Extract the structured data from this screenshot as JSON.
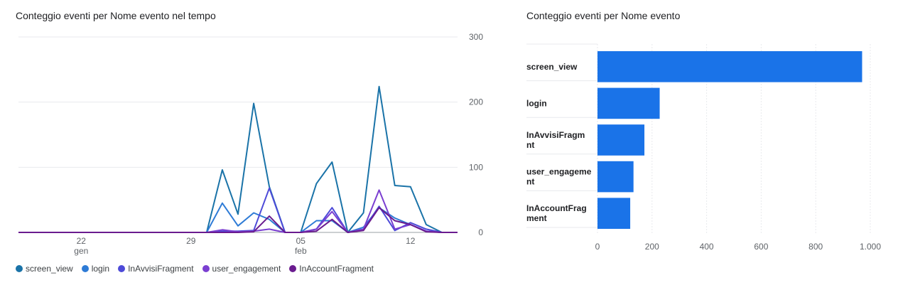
{
  "line_chart_title": "Conteggio eventi per Nome evento nel tempo",
  "bar_chart_title": "Conteggio eventi per Nome evento",
  "chart_data": [
    {
      "type": "line",
      "title": "Conteggio eventi per Nome evento nel tempo",
      "x_ticks": [
        {
          "top": "22",
          "bottom": "gen",
          "date": "01-22"
        },
        {
          "top": "29",
          "bottom": "",
          "date": "01-29"
        },
        {
          "top": "05",
          "bottom": "feb",
          "date": "02-05"
        },
        {
          "top": "12",
          "bottom": "",
          "date": "02-12"
        }
      ],
      "x": [
        "01-18",
        "01-19",
        "01-20",
        "01-21",
        "01-22",
        "01-23",
        "01-24",
        "01-25",
        "01-26",
        "01-27",
        "01-28",
        "01-29",
        "01-30",
        "01-31",
        "02-01",
        "02-02",
        "02-03",
        "02-04",
        "02-05",
        "02-06",
        "02-07",
        "02-08",
        "02-09",
        "02-10",
        "02-11",
        "02-12",
        "02-13",
        "02-14",
        "02-15"
      ],
      "y_ticks": [
        "0",
        "100",
        "200",
        "300"
      ],
      "ylim": [
        0,
        300
      ],
      "y_axis_side": "right",
      "grid": true,
      "legend_position": "bottom",
      "series": [
        {
          "name": "screen_view",
          "color": "#1a73a8",
          "values": [
            0,
            0,
            0,
            0,
            0,
            0,
            0,
            0,
            0,
            0,
            0,
            0,
            0,
            96,
            28,
            198,
            70,
            0,
            0,
            75,
            108,
            0,
            30,
            224,
            72,
            70,
            12,
            0,
            0
          ]
        },
        {
          "name": "login",
          "color": "#2e7bd6",
          "values": [
            0,
            0,
            0,
            0,
            0,
            0,
            0,
            0,
            0,
            0,
            0,
            0,
            0,
            45,
            10,
            30,
            20,
            0,
            0,
            18,
            18,
            0,
            8,
            38,
            22,
            12,
            2,
            0,
            0
          ]
        },
        {
          "name": "InAvvisiFragment",
          "color": "#4d4ad8",
          "values": [
            0,
            0,
            0,
            0,
            0,
            0,
            0,
            0,
            0,
            0,
            0,
            0,
            0,
            2,
            2,
            3,
            68,
            0,
            0,
            5,
            38,
            0,
            5,
            40,
            3,
            15,
            5,
            0,
            0
          ]
        },
        {
          "name": "user_engagement",
          "color": "#7b3fd1",
          "values": [
            0,
            0,
            0,
            0,
            0,
            0,
            0,
            0,
            0,
            0,
            0,
            0,
            0,
            4,
            1,
            2,
            5,
            0,
            0,
            5,
            32,
            0,
            5,
            65,
            5,
            12,
            2,
            0,
            0
          ]
        },
        {
          "name": "InAccountFragment",
          "color": "#6a1b8f",
          "values": [
            0,
            0,
            0,
            0,
            0,
            0,
            0,
            0,
            0,
            0,
            0,
            0,
            0,
            0,
            0,
            1,
            25,
            0,
            0,
            2,
            20,
            0,
            3,
            38,
            18,
            12,
            1,
            0,
            0
          ]
        }
      ]
    },
    {
      "type": "bar",
      "orientation": "horizontal",
      "title": "Conteggio eventi per Nome evento",
      "categories": [
        "screen_view",
        "login",
        "InAvvisiFragment",
        "user_engagement",
        "InAccountFragment"
      ],
      "category_labels": [
        [
          "screen_view"
        ],
        [
          "login"
        ],
        [
          "InAvvisiFragm",
          "nt"
        ],
        [
          "user_engageme",
          "nt"
        ],
        [
          "InAccountFrag",
          "ment"
        ]
      ],
      "values": [
        970,
        228,
        172,
        132,
        120
      ],
      "xlim": [
        0,
        1000
      ],
      "x_ticks": [
        "0",
        "200",
        "400",
        "600",
        "800",
        "1.000"
      ],
      "color": "#1a73e8",
      "grid": true
    }
  ]
}
